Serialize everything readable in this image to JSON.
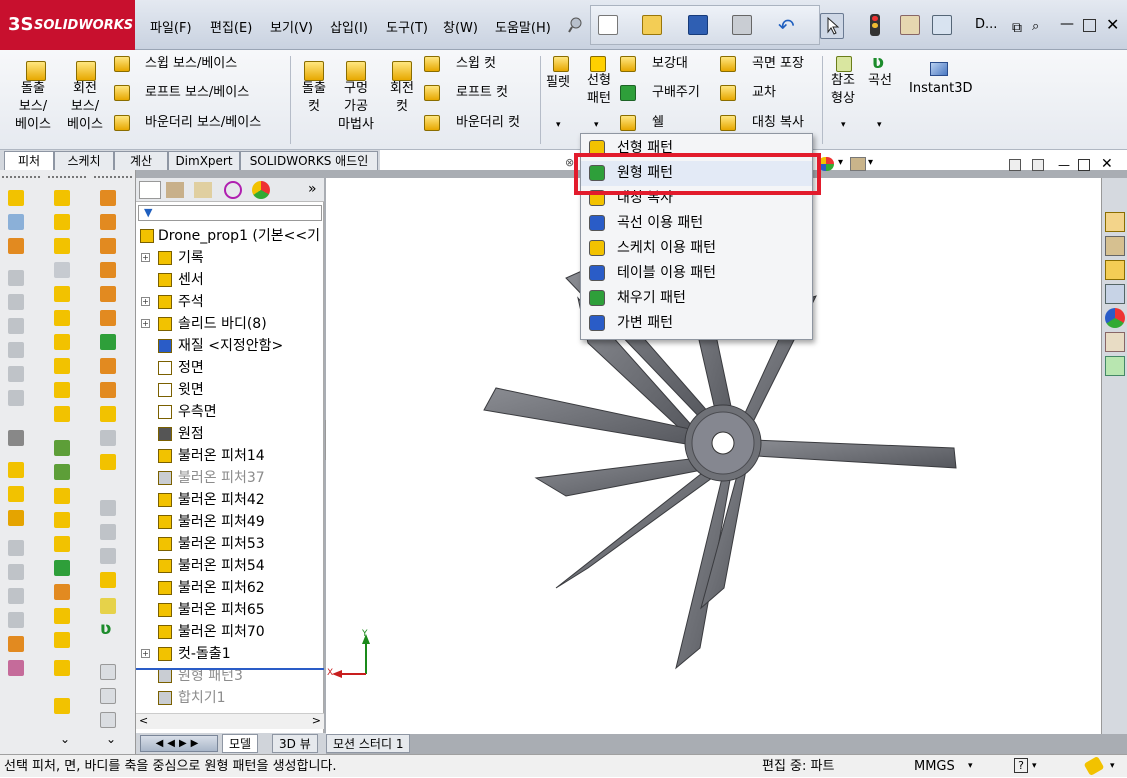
{
  "app": {
    "brand_mark": "3S",
    "brand_name": "SOLIDWORKS"
  },
  "menu": [
    "파일(F)",
    "편집(E)",
    "보기(V)",
    "삽입(I)",
    "도구(T)",
    "창(W)",
    "도움말(H)"
  ],
  "title_right": "D...",
  "ribbon": {
    "extrude_boss": [
      "돌출",
      "보스/",
      "베이스"
    ],
    "revolve_boss": [
      "회전",
      "보스/",
      "베이스"
    ],
    "sweep_boss": "스윕 보스/베이스",
    "loft_boss": "로프트 보스/베이스",
    "boundary_boss": "바운더리 보스/베이스",
    "extrude_cut": [
      "돌출",
      "컷"
    ],
    "hole_wizard": [
      "구멍",
      "가공",
      "마법사"
    ],
    "revolve_cut": [
      "회전",
      "컷"
    ],
    "sweep_cut": "스윕 컷",
    "loft_cut": "로프트 컷",
    "boundary_cut": "바운더리 컷",
    "fillet": "필렛",
    "linear_pattern": [
      "선형",
      "패턴"
    ],
    "rib": "보강대",
    "draft": "구배주기",
    "shell": "쉘",
    "wrap": "곡면 포장",
    "intersect": "교차",
    "mirror": "대칭 복사",
    "ref_geometry": [
      "참조",
      "형상"
    ],
    "curves": "곡선",
    "instant3d": "Instant3D"
  },
  "tabs": [
    "피처",
    "스케치",
    "계산",
    "DimXpert",
    "SOLIDWORKS 애드인"
  ],
  "tree": {
    "root": "Drone_prop1 (기본<<기",
    "items": [
      {
        "label": "기록",
        "expand": "+",
        "muted": false
      },
      {
        "label": "센서",
        "expand": "",
        "muted": false
      },
      {
        "label": "주석",
        "expand": "+",
        "muted": false
      },
      {
        "label": "솔리드 바디(8)",
        "expand": "+",
        "muted": false
      },
      {
        "label": "재질 <지정안함>",
        "expand": "",
        "muted": false
      },
      {
        "label": "정면",
        "expand": "",
        "muted": false
      },
      {
        "label": "윗면",
        "expand": "",
        "muted": false
      },
      {
        "label": "우측면",
        "expand": "",
        "muted": false
      },
      {
        "label": "원점",
        "expand": "",
        "muted": false
      },
      {
        "label": "불러온 피처14",
        "expand": "",
        "muted": false
      },
      {
        "label": "불러온 피처37",
        "expand": "",
        "muted": true
      },
      {
        "label": "불러온 피처42",
        "expand": "",
        "muted": false
      },
      {
        "label": "불러온 피처49",
        "expand": "",
        "muted": false
      },
      {
        "label": "불러온 피처53",
        "expand": "",
        "muted": false
      },
      {
        "label": "불러온 피처54",
        "expand": "",
        "muted": false
      },
      {
        "label": "불러온 피처62",
        "expand": "",
        "muted": false
      },
      {
        "label": "불러온 피처65",
        "expand": "",
        "muted": false
      },
      {
        "label": "불러온 피처70",
        "expand": "",
        "muted": false
      },
      {
        "label": "컷-돌출1",
        "expand": "+",
        "muted": false
      },
      {
        "label": "원형 패턴3",
        "expand": "",
        "muted": true
      },
      {
        "label": "합치기1",
        "expand": "",
        "muted": true
      }
    ]
  },
  "bottom_tabs": [
    "모델",
    "3D 뷰",
    "모션 스터디 1"
  ],
  "dropdown": {
    "items": [
      "선형 패턴",
      "원형 패턴",
      "대칭 복사",
      "곡선 이용 패턴",
      "스케치 이용 패턴",
      "테이블 이용 패턴",
      "채우기 패턴",
      "가변 패턴"
    ],
    "selected_index": 1
  },
  "axes": {
    "x": "X",
    "y": "Y"
  },
  "status": {
    "message": "선택 피처, 면, 바디를 축을 중심으로 원형 패턴을 생성합니다.",
    "mode": "편집 중: 파트",
    "units": "MMGS"
  },
  "colors": {
    "brand_red": "#c8102e",
    "highlight_red": "#e21b2c",
    "feature_yellow": "#f2c200",
    "propeller_gray": "#6f7177"
  }
}
